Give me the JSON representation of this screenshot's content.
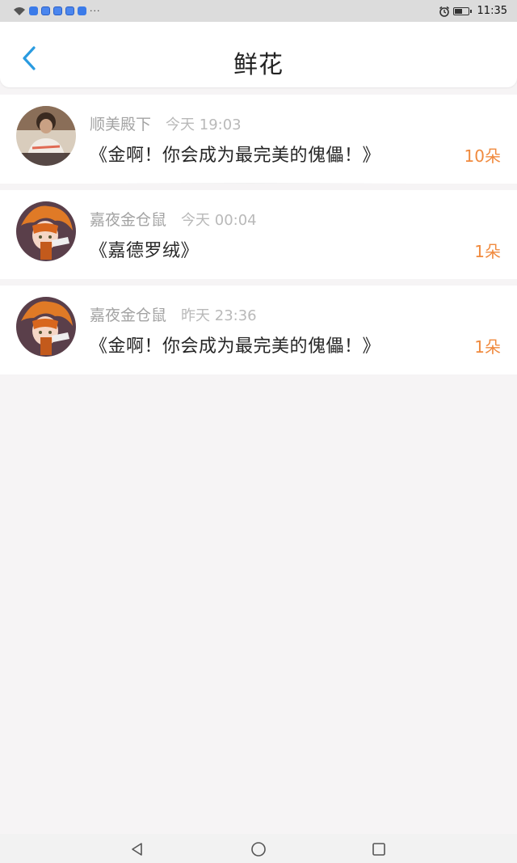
{
  "status_bar": {
    "time": "11:35",
    "overflow": "···",
    "icons": [
      "wifi-icon",
      "app-notification-icon",
      "paw-icon",
      "paw-icon",
      "paw-icon",
      "shield-app-icon",
      "alarm-icon",
      "battery-icon"
    ]
  },
  "header": {
    "title": "鲜花",
    "back_icon": "chevron-left-icon"
  },
  "gifts": [
    {
      "sender": "顺美殿下",
      "time": "今天 19:03",
      "gift_text": "《金啊！你会成为最完美的傀儡！》",
      "count": "10朵",
      "avatar": "user-photo"
    },
    {
      "sender": "嘉夜金仓鼠",
      "time": "今天 00:04",
      "gift_text": "《嘉德罗绒》",
      "count": "1朵",
      "avatar": "anime-character"
    },
    {
      "sender": "嘉夜金仓鼠",
      "time": "昨天 23:36",
      "gift_text": "《金啊！你会成为最完美的傀儡！》",
      "count": "1朵",
      "avatar": "anime-character"
    }
  ],
  "colors": {
    "accent": "#2a9be0",
    "count": "#f08a3e",
    "background": "#f6f4f5"
  },
  "nav_bar": {
    "icons": [
      "back-triangle-icon",
      "home-circle-icon",
      "recent-square-icon"
    ]
  }
}
